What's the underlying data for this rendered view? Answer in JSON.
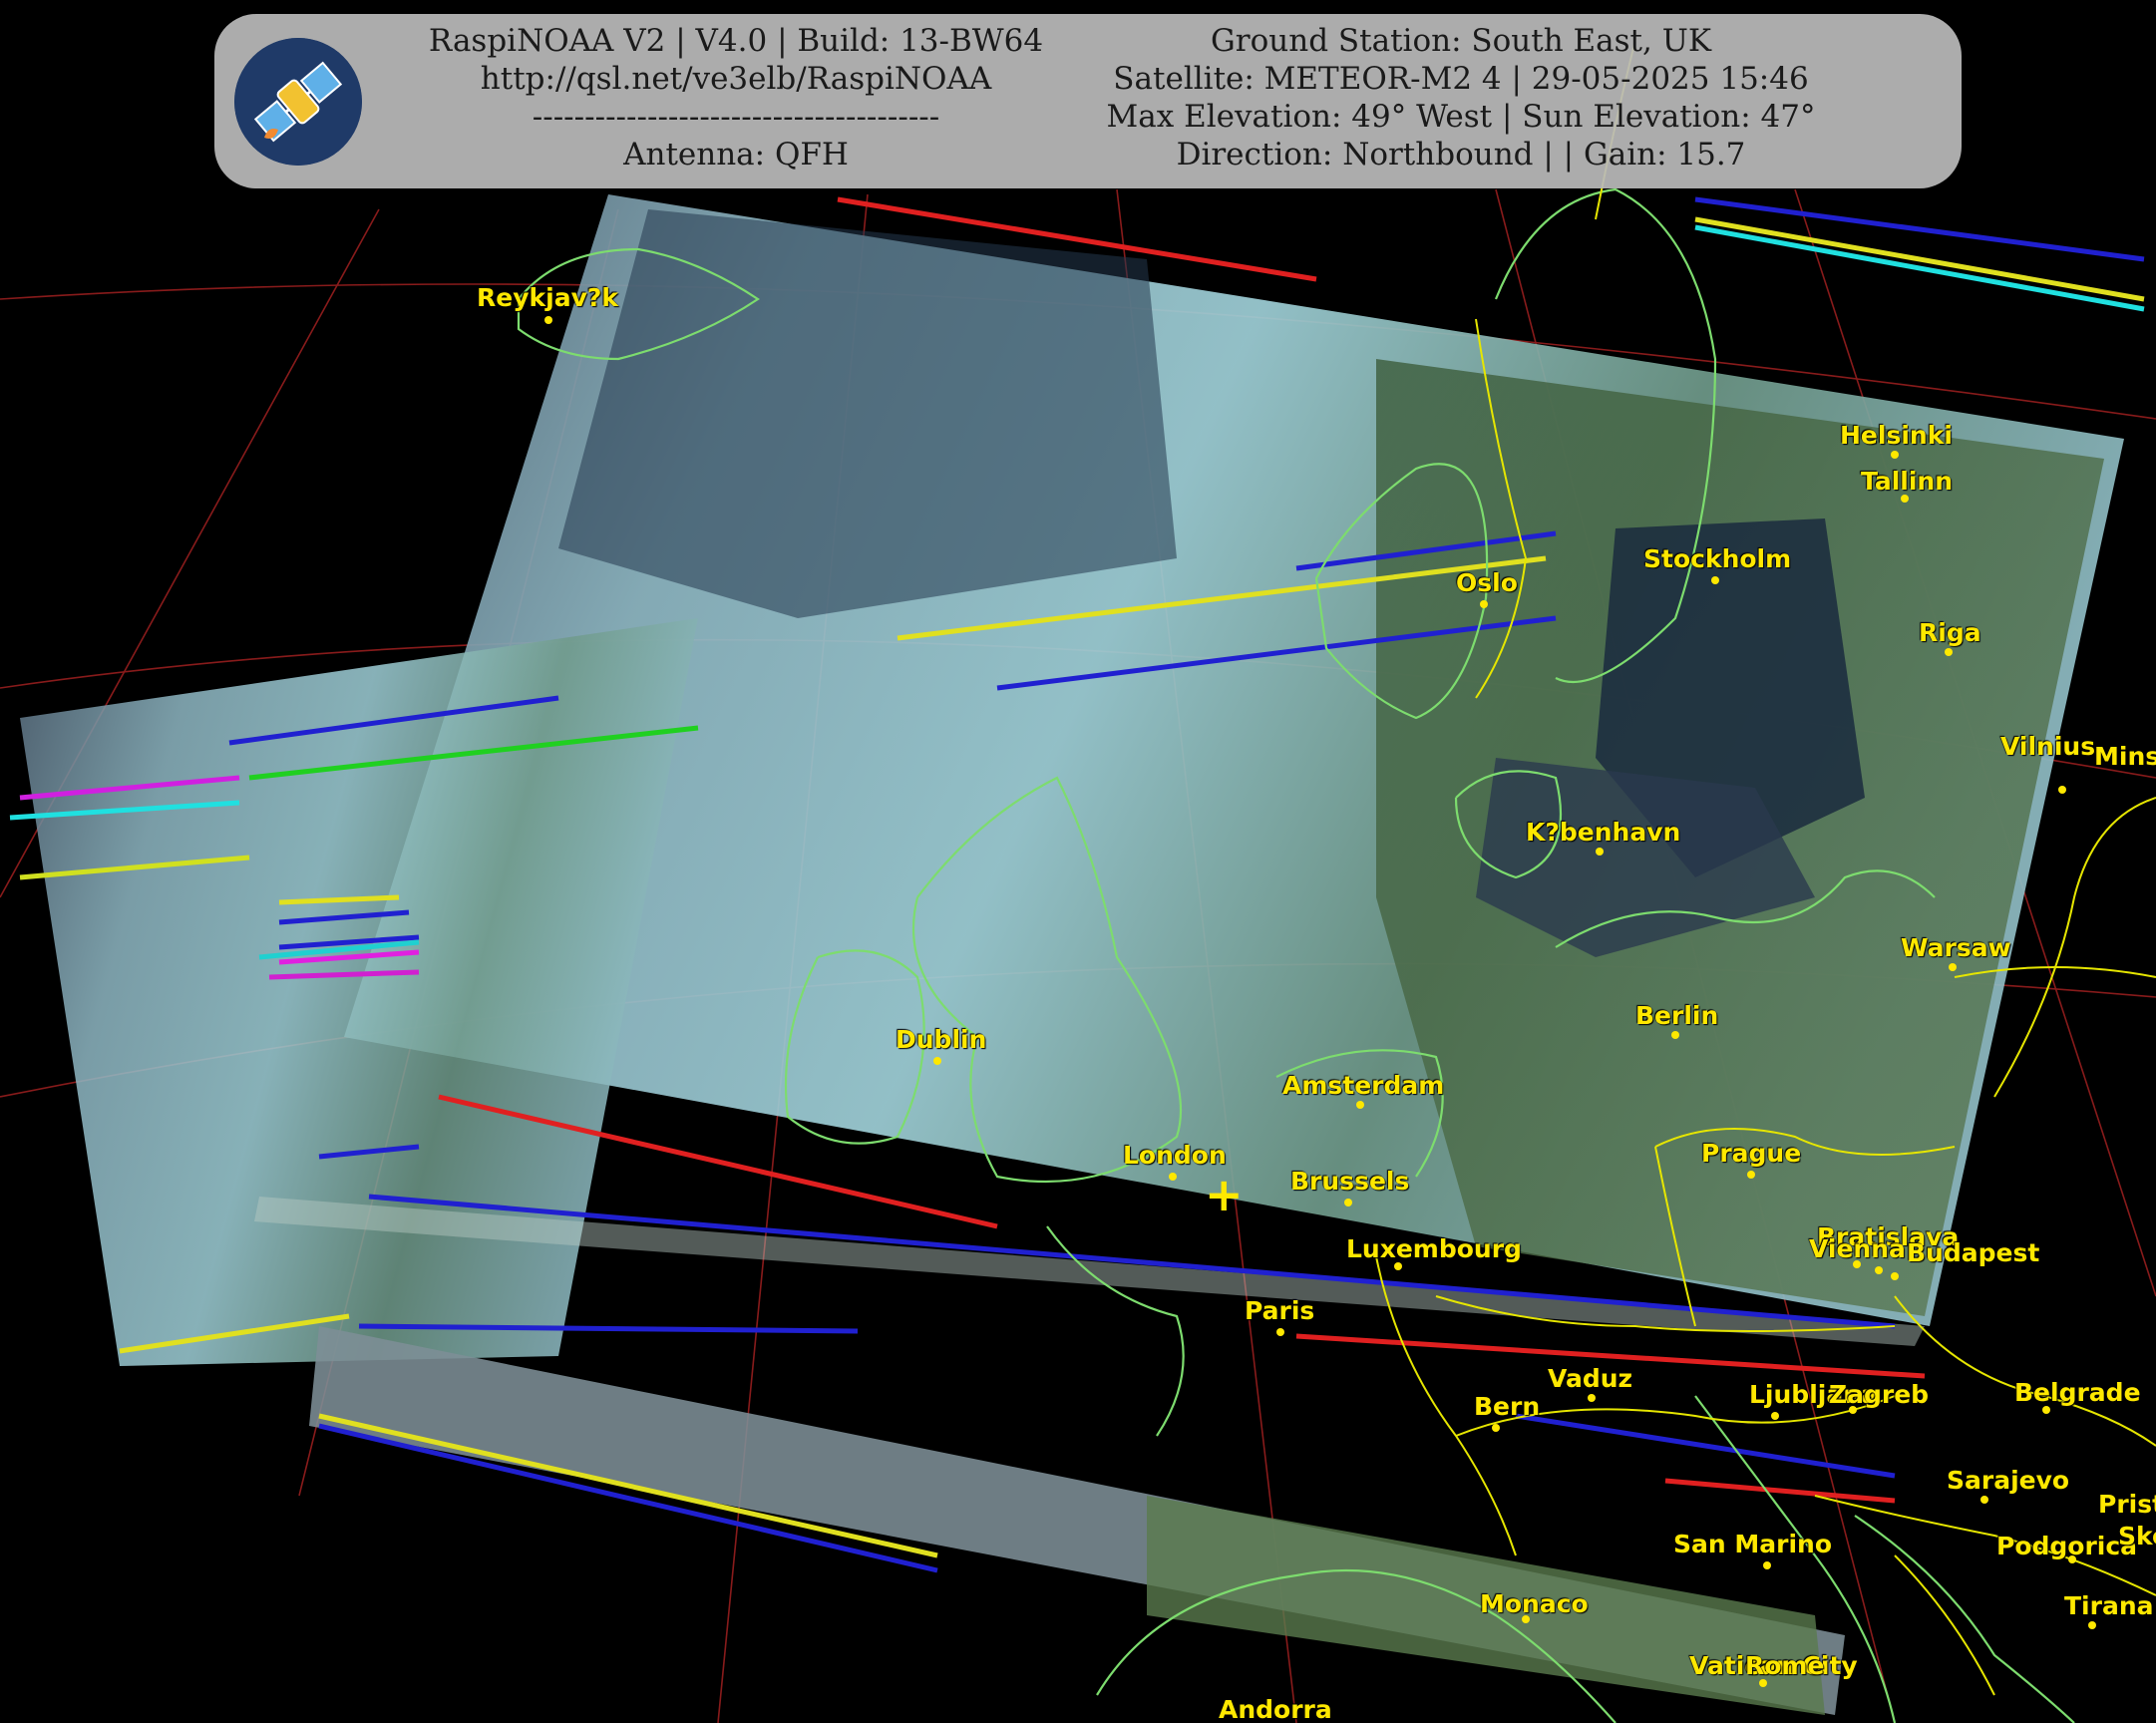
{
  "header": {
    "left_lines": [
      "RaspiNOAA V2 | V4.0 | Build: 13-BW64",
      "http://qsl.net/ve3elb/RaspiNOAA",
      "---------------------------------------",
      "Antenna: QFH"
    ],
    "right_lines": [
      "Ground Station: South East, UK",
      "Satellite: METEOR-M2 4 | 29-05-2025 15:46",
      "Max Elevation: 49° West | Sun Elevation: 47°",
      "Direction: Northbound | | Gain: 15.7"
    ]
  },
  "map": {
    "cities": [
      "Reykjav?k",
      "Oslo",
      "Stockholm",
      "Helsinki",
      "Tallinn",
      "Riga",
      "Vilnius",
      "Minsk",
      "K?benhavn",
      "Warsaw",
      "Berlin",
      "Dublin",
      "Amsterdam",
      "London",
      "Brussels",
      "Luxembourg",
      "Prague",
      "Bratislava",
      "Vienna",
      "Budapest",
      "Paris",
      "Vaduz",
      "Bern",
      "Ljubljana",
      "Zagreb",
      "Belgrade",
      "Sarajevo",
      "San Marino",
      "Podgorica",
      "Pristina",
      "Skopje",
      "Monaco",
      "Tirana",
      "Vatican City",
      "Rome",
      "Andorra"
    ],
    "colors": {
      "label": "#ffe800",
      "coastline": "#7ddc6e",
      "borders": "#e6e600",
      "graticule": "#a02020",
      "background": "#000000"
    },
    "station_marker_icon": "crosshair-icon"
  }
}
